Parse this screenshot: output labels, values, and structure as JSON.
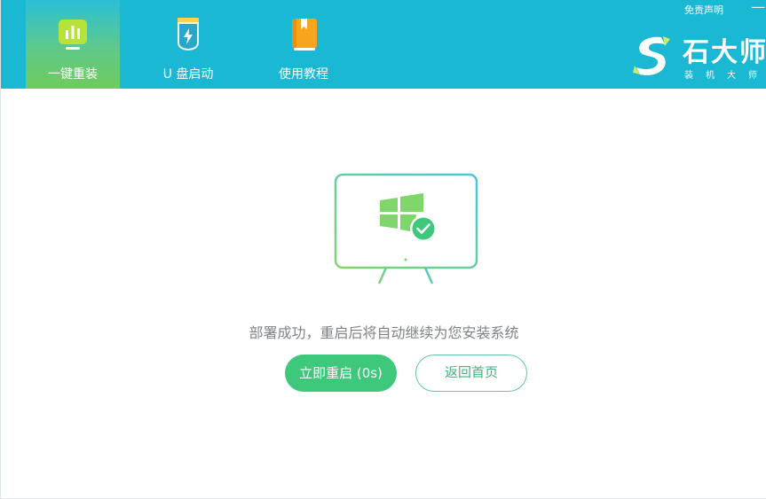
{
  "header": {
    "tabs": [
      {
        "label": "一键重装",
        "icon": "bar-chart-icon",
        "active": true
      },
      {
        "label": "U 盘启动",
        "icon": "usb-drive-icon",
        "active": false
      },
      {
        "label": "使用教程",
        "icon": "book-icon",
        "active": false
      }
    ],
    "disclaimer": "免责声明",
    "minimize": "—",
    "logo": {
      "name": "石大师",
      "sub": "装机大师"
    }
  },
  "main": {
    "status": "部署成功，重启后将自动继续为您安装系统",
    "restart_button": "立即重启 (0s)",
    "home_button": "返回首页"
  },
  "colors": {
    "header_bg": "#1bb8d3",
    "accent_green": "#3ec87c",
    "tab_active_gradient_end": "#6ecc5c"
  }
}
